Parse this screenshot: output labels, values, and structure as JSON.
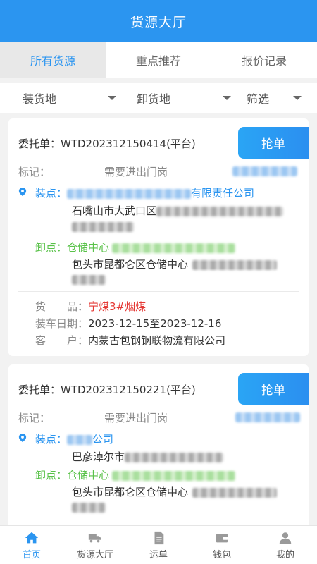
{
  "header": {
    "title": "货源大厅"
  },
  "tabs": [
    {
      "label": "所有货源",
      "active": true
    },
    {
      "label": "重点推荐",
      "active": false
    },
    {
      "label": "报价记录",
      "active": false
    }
  ],
  "filters": {
    "load": "装货地",
    "unload": "卸货地",
    "screen": "筛选"
  },
  "cards": [
    {
      "order_label": "委托单：",
      "order_no": "WTD202312150414(平台)",
      "grab_label": "抢单",
      "mark_label": "标记：",
      "mark_value": "需要进出门岗",
      "load_label": "装点：",
      "load_company_suffix": "有限责任公司",
      "load_address": "石嘴山市大武口区",
      "unload_label": "卸点：",
      "unload_name": "仓储中心",
      "unload_address": "包头市昆都仑区仓储中心",
      "goods_label": "货　　品：",
      "goods_value": "宁煤3#烟煤",
      "date_label": "装车日期：",
      "date_value": "2023-12-15至2023-12-16",
      "customer_label": "客　　户：",
      "customer_value": "内蒙古包钢钢联物流有限公司"
    },
    {
      "order_label": "委托单：",
      "order_no": "WTD202312150221(平台)",
      "grab_label": "抢单",
      "mark_label": "标记：",
      "mark_value": "需要进出门岗",
      "load_label": "装点：",
      "load_company_suffix": "公司",
      "load_address": "巴彦淖尔市",
      "unload_label": "卸点：",
      "unload_name": "仓储中心",
      "unload_address": "包头市昆都仑区仓储中心"
    }
  ],
  "tabbar": [
    {
      "label": "首页",
      "icon": "home-icon",
      "active": true
    },
    {
      "label": "货源大厅",
      "icon": "truck-icon",
      "active": false
    },
    {
      "label": "运单",
      "icon": "document-icon",
      "active": false
    },
    {
      "label": "钱包",
      "icon": "wallet-icon",
      "active": false
    },
    {
      "label": "我的",
      "icon": "user-icon",
      "active": false
    }
  ],
  "colors": {
    "primary": "#2b95f0",
    "green": "#5ac24a",
    "red": "#e53935"
  }
}
